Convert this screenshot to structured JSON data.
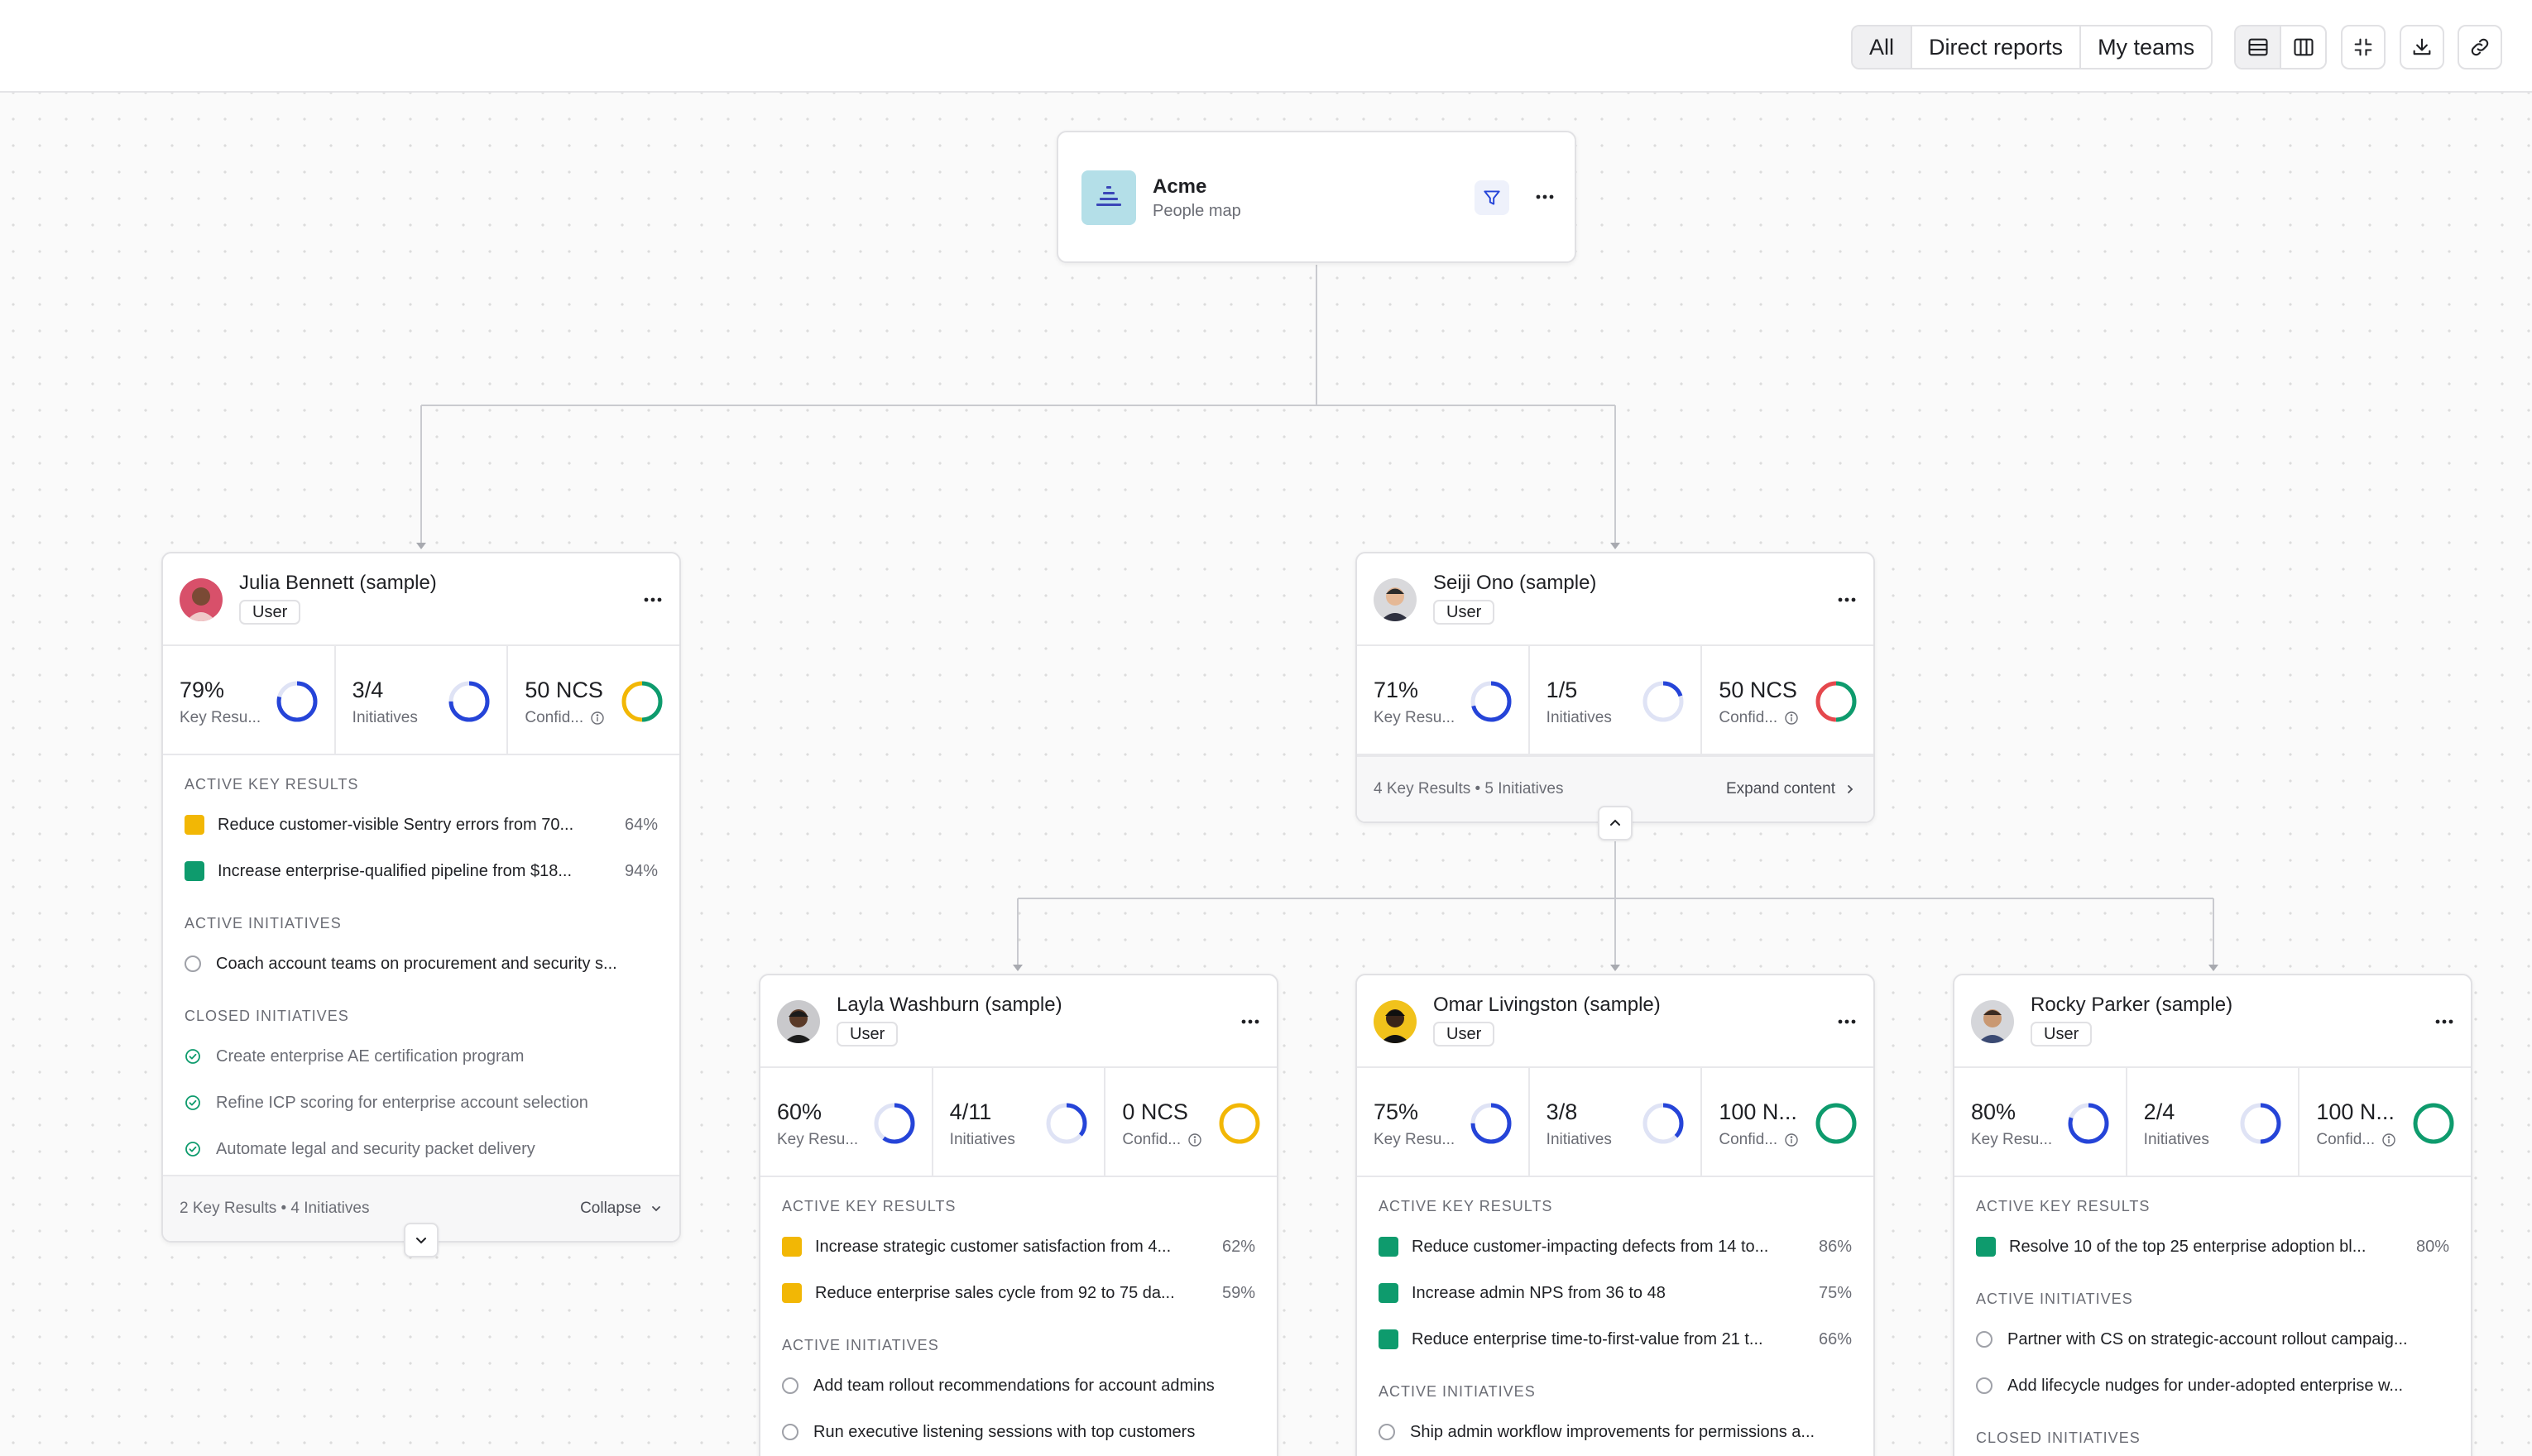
{
  "toolbar": {
    "filters": [
      "All",
      "Direct reports",
      "My teams"
    ],
    "active_filter": "All",
    "icons": [
      "rows-view-icon",
      "columns-view-icon",
      "collapse-icon",
      "download-icon",
      "link-icon"
    ]
  },
  "org": {
    "name": "Acme",
    "subtitle": "People map"
  },
  "cards": [
    {
      "name": "Julia Bennett (sample)",
      "role": "User",
      "stats": [
        {
          "value": "79%",
          "label": "Key Resu...",
          "ring_fraction": 0.79,
          "ring_color": "#2544d8"
        },
        {
          "value": "3/4",
          "label": "Initiatives",
          "ring_fraction": 0.75,
          "ring_color": "#2544d8"
        },
        {
          "value": "50 NCS",
          "label": "Confid...",
          "ring_colors": [
            "#0e9b6d",
            "#f2b705"
          ]
        }
      ],
      "active_key_results_title": "ACTIVE KEY RESULTS",
      "key_results": [
        {
          "text": "Reduce customer-visible Sentry errors from 70...",
          "pct": "64%",
          "color": "amber"
        },
        {
          "text": "Increase enterprise-qualified pipeline from $18...",
          "pct": "94%",
          "color": "green"
        }
      ],
      "active_initiatives_title": "ACTIVE INITIATIVES",
      "initiatives": [
        "Coach account teams on procurement and security s..."
      ],
      "closed_initiatives_title": "CLOSED INITIATIVES",
      "closed_initiatives": [
        "Create enterprise AE certification program",
        "Refine ICP scoring for enterprise account selection",
        "Automate legal and security packet delivery"
      ],
      "footer_summary": "2 Key Results • 4 Initiatives",
      "footer_action": "Collapse"
    },
    {
      "name": "Seiji Ono (sample)",
      "role": "User",
      "stats": [
        {
          "value": "71%",
          "label": "Key Resu...",
          "ring_fraction": 0.71,
          "ring_color": "#2544d8"
        },
        {
          "value": "1/5",
          "label": "Initiatives",
          "ring_fraction": 0.2,
          "ring_color": "#2544d8"
        },
        {
          "value": "50 NCS",
          "label": "Confid...",
          "ring_colors": [
            "#0e9b6d",
            "#e5484d"
          ]
        }
      ],
      "footer_summary": "4 Key Results • 5 Initiatives",
      "footer_action": "Expand content"
    },
    {
      "name": "Layla Washburn (sample)",
      "role": "User",
      "stats": [
        {
          "value": "60%",
          "label": "Key Resu...",
          "ring_fraction": 0.6,
          "ring_color": "#2544d8"
        },
        {
          "value": "4/11",
          "label": "Initiatives",
          "ring_fraction": 0.36,
          "ring_color": "#2544d8"
        },
        {
          "value": "0 NCS",
          "label": "Confid...",
          "ring_colors": [
            "#f2b705"
          ]
        }
      ],
      "active_key_results_title": "ACTIVE KEY RESULTS",
      "key_results": [
        {
          "text": "Increase strategic customer satisfaction from 4...",
          "pct": "62%",
          "color": "amber"
        },
        {
          "text": "Reduce enterprise sales cycle from 92 to 75 da...",
          "pct": "59%",
          "color": "amber"
        }
      ],
      "active_initiatives_title": "ACTIVE INITIATIVES",
      "initiatives": [
        "Add team rollout recommendations for account admins",
        "Run executive listening sessions with top customers"
      ]
    },
    {
      "name": "Omar Livingston (sample)",
      "role": "User",
      "stats": [
        {
          "value": "75%",
          "label": "Key Resu...",
          "ring_fraction": 0.75,
          "ring_color": "#2544d8"
        },
        {
          "value": "3/8",
          "label": "Initiatives",
          "ring_fraction": 0.375,
          "ring_color": "#2544d8"
        },
        {
          "value": "100 N...",
          "label": "Confid...",
          "ring_colors": [
            "#0e9b6d"
          ]
        }
      ],
      "active_key_results_title": "ACTIVE KEY RESULTS",
      "key_results": [
        {
          "text": "Reduce customer-impacting defects from 14 to...",
          "pct": "86%",
          "color": "green"
        },
        {
          "text": "Increase admin NPS from 36 to 48",
          "pct": "75%",
          "color": "green"
        },
        {
          "text": "Reduce enterprise time-to-first-value from 21 t...",
          "pct": "66%",
          "color": "green"
        }
      ],
      "active_initiatives_title": "ACTIVE INITIATIVES",
      "initiatives": [
        "Ship admin workflow improvements for permissions a..."
      ]
    },
    {
      "name": "Rocky Parker (sample)",
      "role": "User",
      "stats": [
        {
          "value": "80%",
          "label": "Key Resu...",
          "ring_fraction": 0.8,
          "ring_color": "#2544d8"
        },
        {
          "value": "2/4",
          "label": "Initiatives",
          "ring_fraction": 0.5,
          "ring_color": "#2544d8"
        },
        {
          "value": "100 N...",
          "label": "Confid...",
          "ring_colors": [
            "#0e9b6d"
          ]
        }
      ],
      "active_key_results_title": "ACTIVE KEY RESULTS",
      "key_results": [
        {
          "text": "Resolve 10 of the top 25 enterprise adoption bl...",
          "pct": "80%",
          "color": "green"
        }
      ],
      "active_initiatives_title": "ACTIVE INITIATIVES",
      "initiatives": [
        "Partner with CS on strategic-account rollout campaig...",
        "Add lifecycle nudges for under-adopted enterprise w..."
      ],
      "closed_initiatives_title": "CLOSED INITIATIVES"
    }
  ],
  "colors": {
    "accent": "#2544d8",
    "green": "#0e9b6d",
    "amber": "#f2b705",
    "red": "#e5484d"
  }
}
